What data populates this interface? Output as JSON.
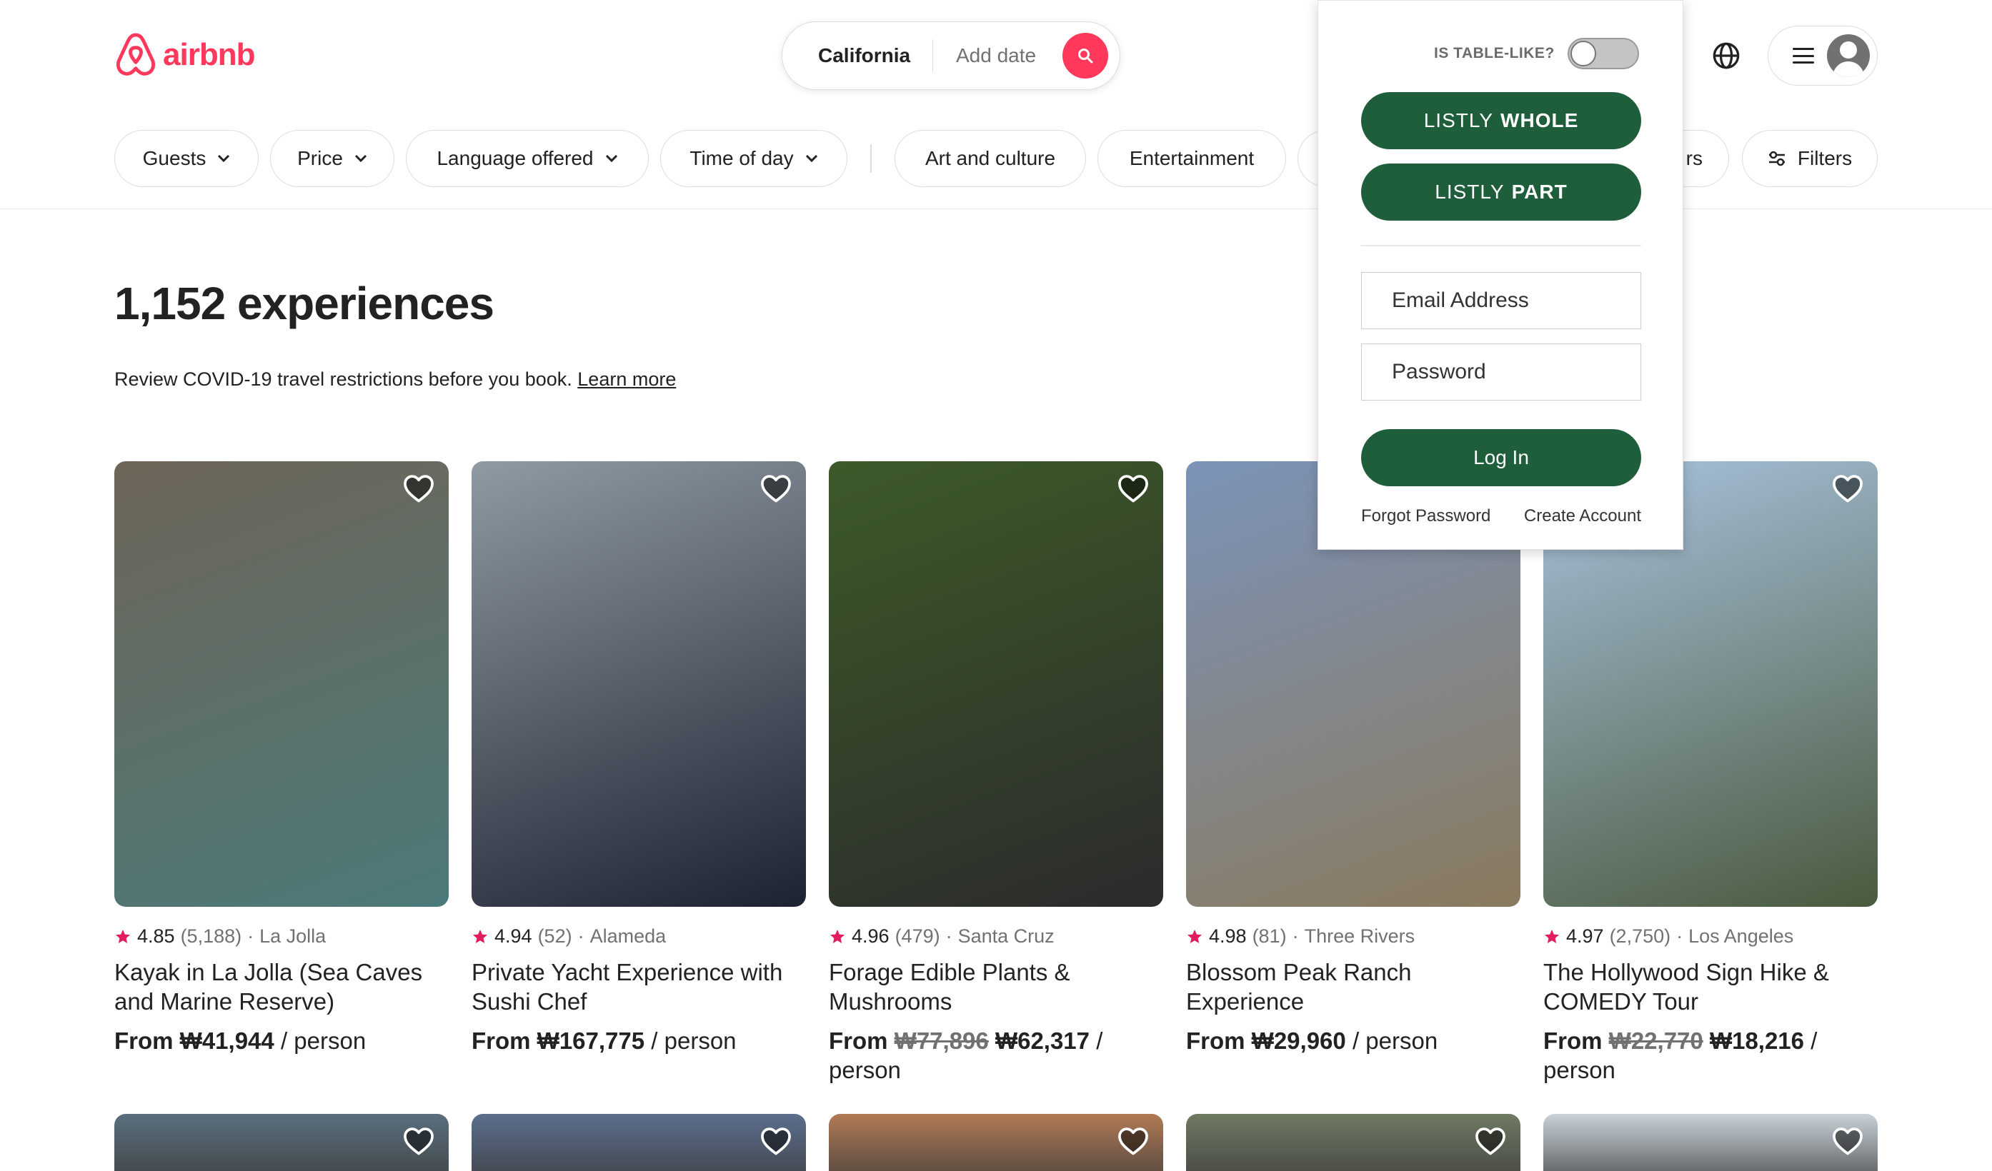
{
  "header": {
    "logo_text": "airbnb",
    "brand_color": "#FF385C",
    "search": {
      "location": "California",
      "date_placeholder": "Add date"
    }
  },
  "filters": {
    "dropdowns": [
      "Guests",
      "Price",
      "Language offered",
      "Time of day"
    ],
    "categories": [
      "Art and culture",
      "Entertainment"
    ],
    "partial_pill_text": "rs",
    "filters_label": "Filters"
  },
  "main": {
    "title": "1,152 experiences",
    "covid_text": "Review COVID-19 travel restrictions before you book.",
    "covid_link": "Learn more"
  },
  "listings": [
    {
      "rating": "4.85",
      "reviews": "(5,188)",
      "location": "La Jolla",
      "title": "Kayak in La Jolla (Sea Caves and Marine Reserve)",
      "price_prefix": "From",
      "old_price": "",
      "price": "₩41,944",
      "unit": "/ person",
      "photo_tone": [
        "#6e6558",
        "#4c7a7a"
      ]
    },
    {
      "rating": "4.94",
      "reviews": "(52)",
      "location": "Alameda",
      "title": "Private Yacht Experience with Sushi Chef",
      "price_prefix": "From",
      "old_price": "",
      "price": "₩167,775",
      "unit": "/ person",
      "photo_tone": [
        "#8f9aa3",
        "#1d2230"
      ]
    },
    {
      "rating": "4.96",
      "reviews": "(479)",
      "location": "Santa Cruz",
      "title": "Forage Edible Plants & Mushrooms",
      "price_prefix": "From",
      "old_price": "₩77,896",
      "price": "₩62,317",
      "unit": "/ person",
      "photo_tone": [
        "#3d5a2a",
        "#2b2b2b"
      ]
    },
    {
      "rating": "4.98",
      "reviews": "(81)",
      "location": "Three Rivers",
      "title": "Blossom Peak Ranch Experience",
      "price_prefix": "From",
      "old_price": "",
      "price": "₩29,960",
      "unit": "/ person",
      "photo_tone": [
        "#7b93b8",
        "#8a7a5e"
      ]
    },
    {
      "rating": "4.97",
      "reviews": "(2,750)",
      "location": "Los Angeles",
      "title": "The Hollywood Sign Hike & COMEDY Tour",
      "price_prefix": "From",
      "old_price": "₩22,770",
      "price": "₩18,216",
      "unit": "/ person",
      "photo_tone": [
        "#a9c3de",
        "#4a5a3e"
      ]
    }
  ],
  "second_row_tones": [
    "#5a6f7e",
    "#5b6e8c",
    "#b07a55",
    "#6f7a62",
    "#c9d2d9"
  ],
  "listly": {
    "table_like_label": "IS TABLE-LIKE?",
    "whole_button": {
      "prefix": "LISTLY",
      "emphasis": "WHOLE"
    },
    "part_button": {
      "prefix": "LISTLY",
      "emphasis": "PART"
    },
    "email_placeholder": "Email Address",
    "password_placeholder": "Password",
    "login_label": "Log In",
    "forgot_label": "Forgot Password",
    "create_label": "Create Account",
    "accent_color": "#1f5e3b"
  }
}
